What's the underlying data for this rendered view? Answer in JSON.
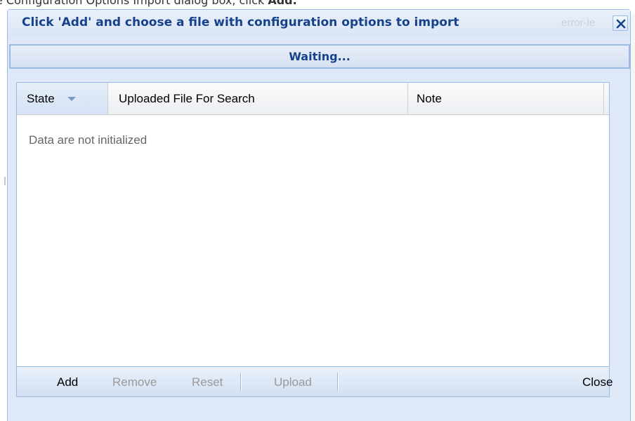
{
  "document": {
    "caption_prefix": "e Configuration Options Import dialog box, click ",
    "caption_bold": "Add."
  },
  "dialog": {
    "title": "Click 'Add' and choose a file with configuration options to import",
    "background_text": "error-le",
    "close_icon": "close-x-icon",
    "status": "Waiting..."
  },
  "grid": {
    "columns": [
      {
        "label": "State",
        "sorted": "descending"
      },
      {
        "label": "Uploaded File For Search"
      },
      {
        "label": "Note"
      }
    ],
    "empty_message": "Data are not initialized"
  },
  "toolbar": {
    "add_label": "Add",
    "remove_label": "Remove",
    "reset_label": "Reset",
    "upload_label": "Upload",
    "close_label": "Close"
  },
  "colors": {
    "title": "#15428b",
    "panel_border": "#99bbe8",
    "panel_bg": "#dfe8f6",
    "disabled_text": "#9a9a9a"
  }
}
